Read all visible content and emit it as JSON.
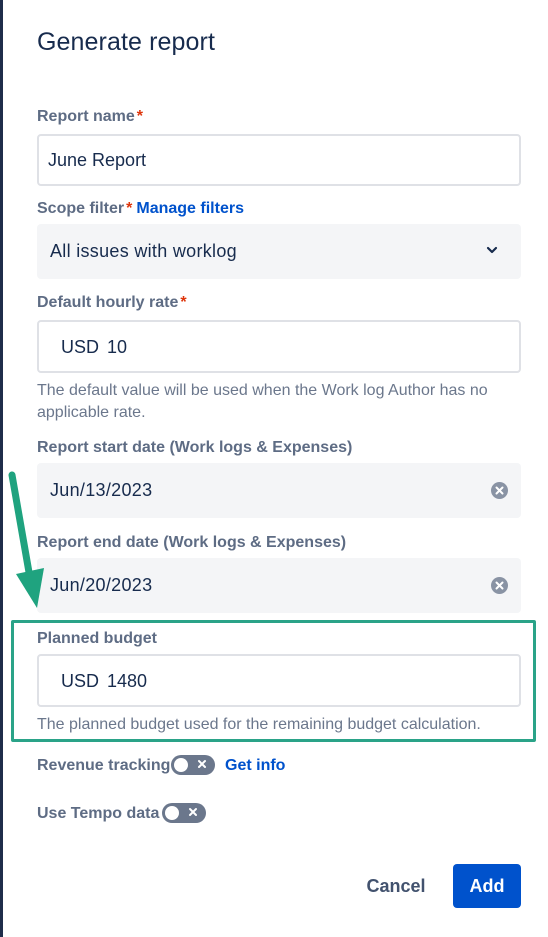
{
  "dialog": {
    "title": "Generate report"
  },
  "report_name": {
    "label": "Report name",
    "required_mark": "*",
    "value": "June Report"
  },
  "scope_filter": {
    "label": "Scope filter",
    "required_mark": "*",
    "link": "Manage filters",
    "value": "All issues with worklog"
  },
  "hourly_rate": {
    "label": "Default hourly rate",
    "required_mark": "*",
    "currency": "USD",
    "value": "10",
    "help_line1": "The default value will be used when the Work log Author has no",
    "help_line2": "applicable rate."
  },
  "start_date": {
    "label": "Report start date (Work logs & Expenses)",
    "value": "Jun/13/2023"
  },
  "end_date": {
    "label": "Report end date (Work logs & Expenses)",
    "value": "Jun/20/2023"
  },
  "planned_budget": {
    "label": "Planned budget",
    "currency": "USD",
    "value": "1480",
    "help": "The planned budget used for the remaining budget calculation."
  },
  "revenue_tracking": {
    "label": "Revenue tracking",
    "enabled": false,
    "link": "Get info"
  },
  "tempo_data": {
    "label": "Use Tempo data",
    "enabled": false
  },
  "actions": {
    "cancel": "Cancel",
    "add": "Add"
  },
  "colors": {
    "primary": "#0052cc",
    "highlight_box": "#2aa388",
    "arrow": "#1fa37f",
    "required": "#de350b"
  }
}
